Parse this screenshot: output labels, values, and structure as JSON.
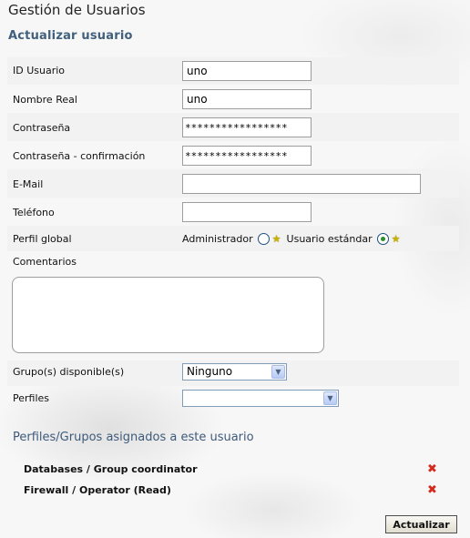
{
  "page": {
    "title": "Gestión de Usuarios",
    "section_title": "Actualizar usuario"
  },
  "form": {
    "id_label": "ID Usuario",
    "id_value": "uno",
    "name_label": "Nombre Real",
    "name_value": "uno",
    "password_label": "Contraseña",
    "password_value": "*****************",
    "password_confirm_label": "Contraseña - confirmación",
    "password_confirm_value": "*****************",
    "email_label": "E-Mail",
    "email_value": "",
    "phone_label": "Teléfono",
    "phone_value": "",
    "profile_label": "Perfil global",
    "profile_options": [
      {
        "label": "Administrador",
        "selected": false
      },
      {
        "label": "Usuario estándar",
        "selected": true
      }
    ],
    "comments_label": "Comentarios",
    "comments_value": "",
    "groups_label": "Grupo(s) disponible(s)",
    "groups_selected": "Ninguno",
    "profiles_label": "Perfiles",
    "profiles_selected": ""
  },
  "assigned": {
    "title": "Perfiles/Grupos asignados a este usuario",
    "items": [
      {
        "label": "Databases / Group coordinator"
      },
      {
        "label": "Firewall / Operator (Read)"
      }
    ]
  },
  "actions": {
    "update_label": "Actualizar"
  },
  "icons": {
    "delete": "delete-x-icon",
    "star": "star-icon",
    "dropdown": "chevron-down-icon"
  },
  "colors": {
    "section_title": "#41607d",
    "delete_icon": "#d42a1e",
    "radio_selected": "#2a8f2a"
  }
}
